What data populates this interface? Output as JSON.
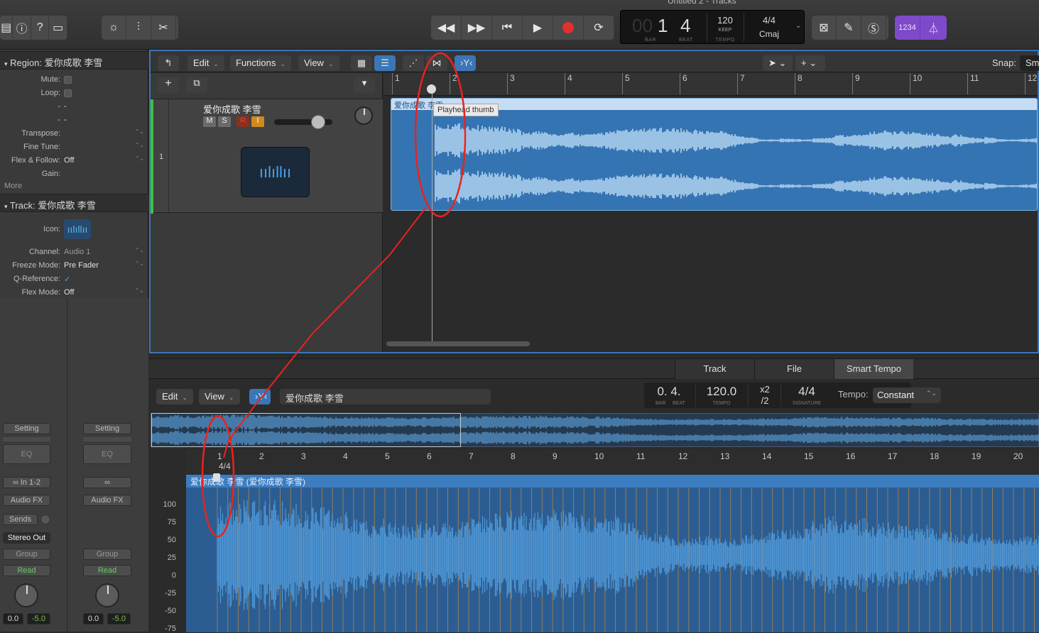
{
  "window_title": "Untitled 2 - Tracks",
  "lcd": {
    "bar_dim": "00",
    "bar": "1",
    "beat": "4",
    "bar_label": "BAR",
    "beat_label": "BEAT",
    "tempo": "120",
    "tempo_mode": "KEEP",
    "tempo_label": "TEMPO",
    "signature": "4/4",
    "key": "Cmaj"
  },
  "count_in_label": "1234",
  "region_inspector": {
    "header_label": "Region:",
    "region_name": "爱你成歌  李雪",
    "rows": [
      {
        "key": "Mute:",
        "value": ""
      },
      {
        "key": "Loop:",
        "value": ""
      },
      {
        "key": "-",
        "value": "-"
      },
      {
        "key": "-",
        "value": "-"
      },
      {
        "key": "Transpose:",
        "value": ""
      },
      {
        "key": "Fine Tune:",
        "value": ""
      },
      {
        "key": "Flex & Follow:",
        "value": "Off"
      },
      {
        "key": "Gain:",
        "value": ""
      }
    ],
    "more_label": "More"
  },
  "track_inspector": {
    "header_label": "Track:",
    "track_name": "爱你成歌  李雪",
    "icon_label": "Icon:",
    "rows": [
      {
        "key": "Channel:",
        "value": "Audio 1"
      },
      {
        "key": "Freeze Mode:",
        "value": "Pre Fader"
      },
      {
        "key": "Q-Reference:",
        "value": "✓"
      },
      {
        "key": "Flex Mode:",
        "value": "Off"
      }
    ]
  },
  "channel_strips": [
    {
      "setting": "Setting",
      "eq": "EQ",
      "input": "In 1-2",
      "audio_fx": "Audio FX",
      "sends": "Sends",
      "output": "Stereo Out",
      "group": "Group",
      "automation": "Read",
      "volume": "0.0",
      "pan": "-5.0"
    },
    {
      "setting": "Setting",
      "eq": "EQ",
      "input": "",
      "audio_fx": "Audio FX",
      "sends": "",
      "output": "",
      "group": "Group",
      "automation": "Read",
      "volume": "0.0",
      "pan": "-5.0"
    }
  ],
  "tracks_menu": {
    "edit": "Edit",
    "functions": "Functions",
    "view": "View",
    "snap_label": "Snap:",
    "snap_value": "Sm"
  },
  "track_header": {
    "number": "1",
    "name": "爱你成歌  李雪",
    "mute": "M",
    "solo": "S",
    "record": "R",
    "input": "I",
    "volume_level": 0.78
  },
  "ruler_top": [
    "1",
    "2",
    "3",
    "4",
    "5",
    "6",
    "7",
    "8",
    "9",
    "10",
    "11",
    "12"
  ],
  "region": {
    "name": "爱你成歌  李雪",
    "tooltip": "Playhead thumb"
  },
  "editor": {
    "tabs": [
      "Track",
      "File",
      "Smart Tempo"
    ],
    "edit_label": "Edit",
    "view_label": "View",
    "region_name": "爱你成歌  李雪",
    "position": "0. 4.",
    "bar_label": "BAR",
    "beat_label": "BEAT",
    "tempo": "120.0",
    "tempo_label": "TEMPO",
    "mult": "x2",
    "div": "/2",
    "signature": "4/4",
    "signature_label": "SIGNATURE",
    "tempo_mode_label": "Tempo:",
    "tempo_mode_value": "Constant",
    "ruler": [
      "1",
      "2",
      "3",
      "4",
      "5",
      "6",
      "7",
      "8",
      "9",
      "10",
      "11",
      "12",
      "13",
      "14",
      "15",
      "16",
      "17",
      "18",
      "19",
      "20"
    ],
    "ruler_sig": "4/4",
    "region_title": "爱你成歌  李雪 (爱你成歌  李雪)",
    "y_axis": [
      "100",
      "75",
      "50",
      "25",
      "0",
      "-25",
      "-50",
      "-75"
    ]
  },
  "colors": {
    "accent": "#3b76b7",
    "region_bg": "#3574b3",
    "waveform": "#bcdcf5",
    "record": "#e0302f",
    "annotation": "#e8231f",
    "count_in": "#7e4ac9"
  }
}
